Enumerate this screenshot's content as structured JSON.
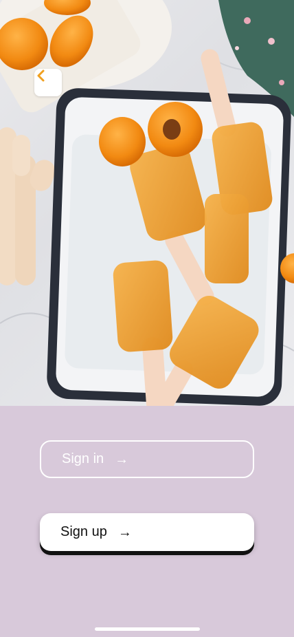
{
  "nav": {
    "back_icon": "chevron-left-icon",
    "accent": "#f0a020"
  },
  "auth": {
    "sign_in_label": "Sign in",
    "sign_up_label": "Sign up",
    "arrow_glyph": "→"
  },
  "colors": {
    "sheet_background": "#d8c9da",
    "primary_button": "#ffffff",
    "primary_text": "#111111",
    "outline": "#ffffff"
  }
}
